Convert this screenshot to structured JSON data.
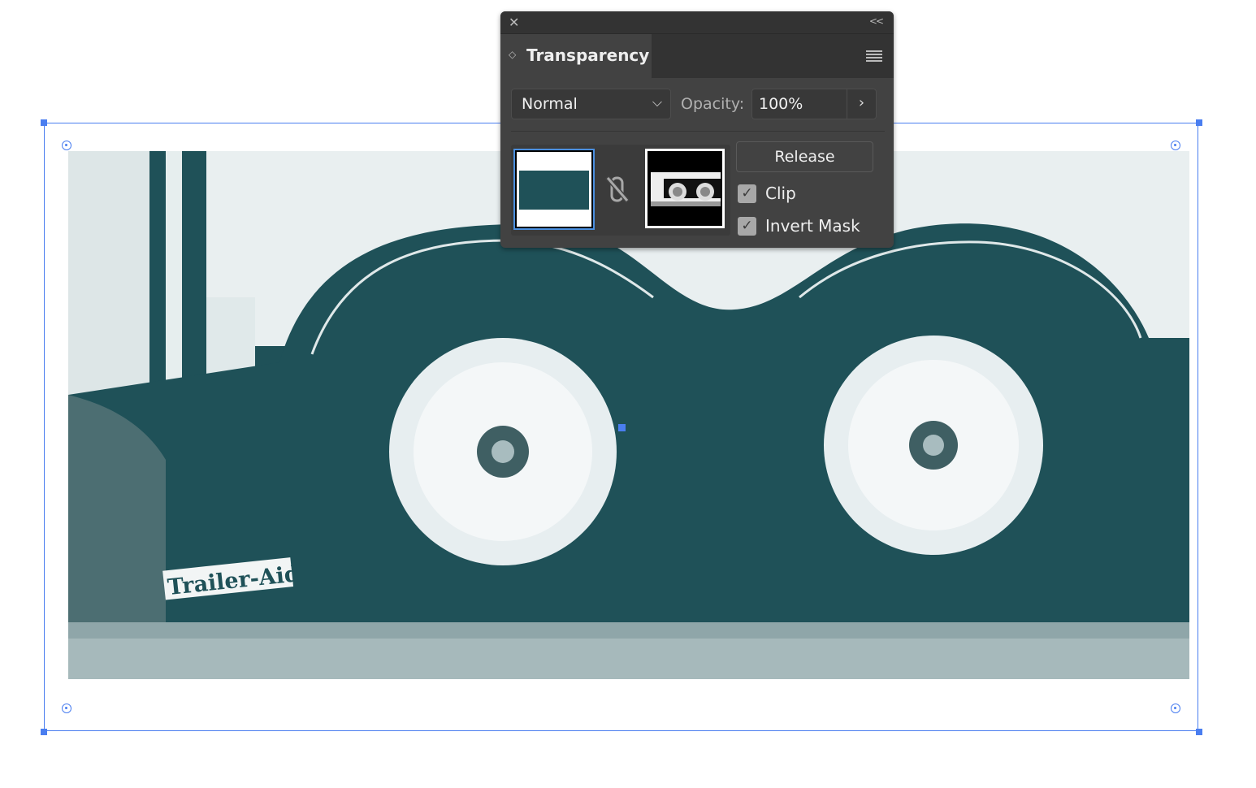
{
  "panel": {
    "close_icon": "close-icon",
    "collapse_icon": "double-chevron-left-icon",
    "tab_title": "Transparency",
    "menu_icon": "hamburger-menu-icon",
    "blend_mode": "Normal",
    "opacity_label": "Opacity:",
    "opacity_value": "100%",
    "release_label": "Release",
    "clip_label": "Clip",
    "clip_checked": true,
    "invert_mask_label": "Invert Mask",
    "invert_mask_checked": true
  },
  "colors": {
    "fill": "#1f5158",
    "selection": "#4a7ef0",
    "panel_bg": "#424242"
  },
  "canvas": {
    "photo_text": "Trailer-Aid"
  }
}
